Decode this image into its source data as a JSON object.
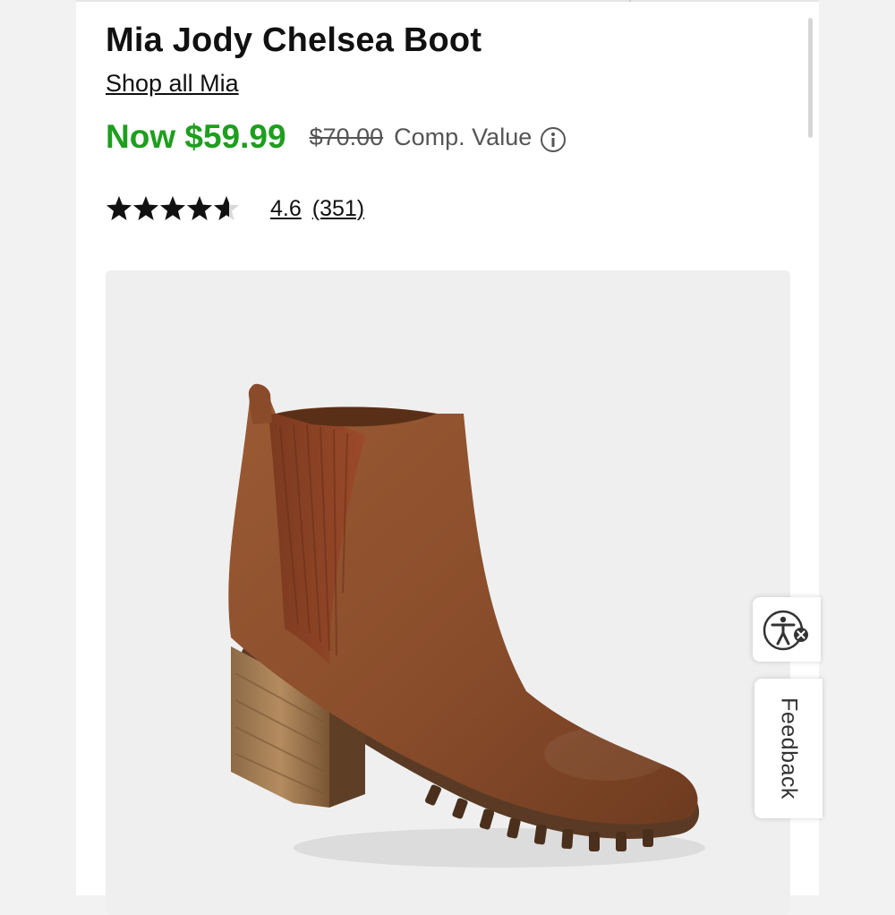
{
  "product": {
    "title": "Mia Jody Chelsea Boot",
    "shop_link": "Shop all Mia",
    "price": {
      "now": "Now $59.99",
      "original": "$70.00",
      "comp_label": "Comp. Value"
    },
    "rating": {
      "value": "4.6",
      "count": "(351)",
      "stars_filled": 4.6,
      "stars_total": 5
    },
    "image": {
      "alt": "brown leather chelsea boot with stacked heel and lug sole"
    }
  },
  "widgets": {
    "accessibility_icon": "accessibility-icon",
    "feedback_label": "Feedback"
  },
  "colors": {
    "sale_price": "#1e9e1e",
    "text": "#111111",
    "muted": "#555555",
    "image_bg": "#efefef"
  }
}
